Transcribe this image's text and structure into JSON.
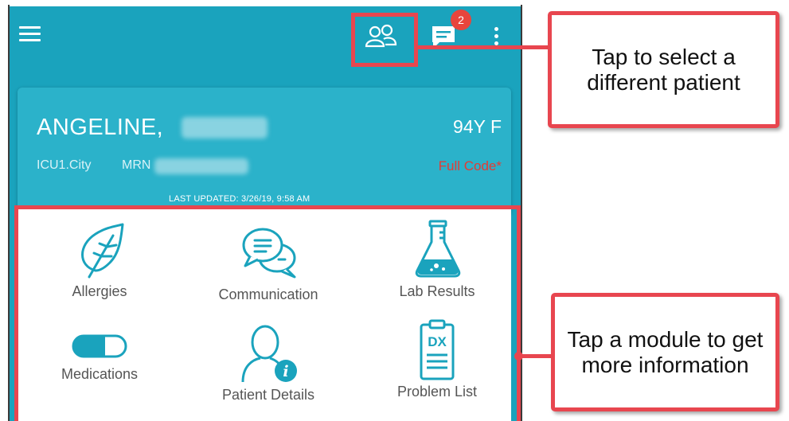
{
  "app_bar": {
    "menu_icon": "hamburger-menu-icon",
    "select_patient_icon": "patients-icon",
    "messages_icon": "chat-icon",
    "messages_badge": "2",
    "overflow_icon": "more-vertical-icon",
    "color": "#1aa3bd"
  },
  "patient": {
    "name": "ANGELINE,",
    "age_sex": "94Y F",
    "unit": "ICU1.City",
    "mrn_label": "MRN",
    "code_status": "Full Code*",
    "last_updated": "LAST UPDATED: 3/26/19, 9:58 AM"
  },
  "modules": [
    {
      "label": "Allergies",
      "icon": "leaf-icon"
    },
    {
      "label": "Communication",
      "icon": "chat-bubbles-icon"
    },
    {
      "label": "Lab Results",
      "icon": "flask-icon"
    },
    {
      "label": "Medications",
      "icon": "pill-icon"
    },
    {
      "label": "Patient Details",
      "icon": "person-info-icon"
    },
    {
      "label": "Problem List",
      "icon": "clipboard-dx-icon",
      "icon_text": "DX"
    }
  ],
  "callouts": {
    "select_patient": "Tap to select a different patient",
    "module": "Tap a module to get more information"
  },
  "colors": {
    "highlight": "#e8464f",
    "badge": "#e8453c",
    "code_status": "#e53b33"
  }
}
